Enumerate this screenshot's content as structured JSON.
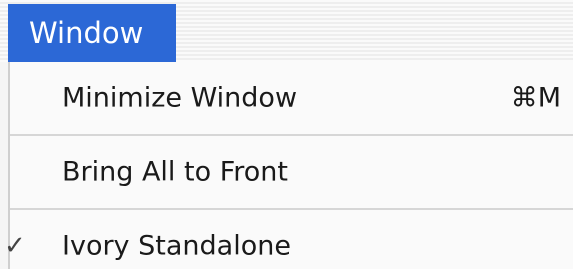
{
  "menu": {
    "title": "Window",
    "items": [
      {
        "label": "Minimize Window",
        "shortcut": "⌘M",
        "checked": false
      },
      {
        "label": "Bring All to Front",
        "shortcut": "",
        "checked": false
      },
      {
        "label": "Ivory Standalone",
        "shortcut": "",
        "checked": true
      }
    ],
    "check_glyph": "✓"
  },
  "colors": {
    "menu_title_bg": "#2c68d6",
    "menu_title_text": "#ffffff",
    "menu_item_text": "#1a1a1a",
    "separator": "#d6d6d6"
  }
}
